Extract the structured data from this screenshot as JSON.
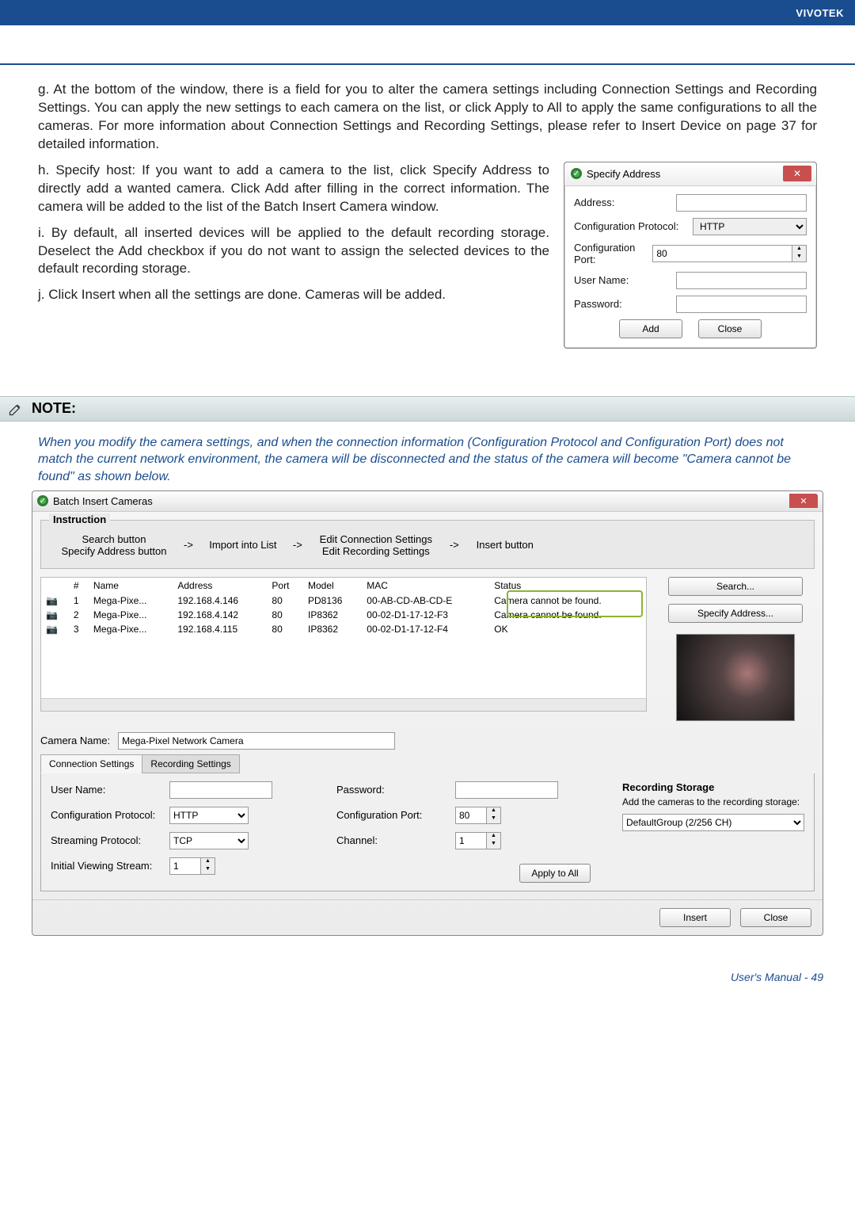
{
  "brand": "VIVOTEK",
  "paragraphs": {
    "g": "At the bottom of the window, there is a field for you to alter the camera settings including Connection Settings and Recording Settings. You can apply the new settings to each camera on the list, or click Apply to All to apply the same configurations to all the cameras. For more information about Connection Settings and Recording Settings, please refer to Insert Device on page 37 for detailed information.",
    "h": "Specify host: If you want to add a camera to the list, click Specify Address to directly add a wanted camera. Click Add after filling in the correct information. The camera will be added to the list of the Batch Insert Camera window.",
    "i": "By default, all inserted devices will be applied to the default recording storage. Deselect the Add checkbox if you do not want to assign the selected devices to the default recording storage.",
    "j": "Click Insert when all the settings are done. Cameras will be added."
  },
  "specify_dialog": {
    "title": "Specify Address",
    "address": "Address:",
    "config_protocol": "Configuration Protocol:",
    "config_protocol_value": "HTTP",
    "config_port": "Configuration Port:",
    "config_port_value": "80",
    "user_name": "User Name:",
    "password": "Password:",
    "add": "Add",
    "close": "Close"
  },
  "note_title": "NOTE:",
  "note_text": "When you modify the camera settings, and when the connection information (Configuration Protocol and Configuration Port) does not match the current network environment, the camera will be disconnected and the status of the camera will become \"Camera cannot be found\" as shown below.",
  "batch_dialog": {
    "title": "Batch Insert Cameras",
    "instruction_title": "Instruction",
    "instr": {
      "c1a": "Search button",
      "c1b": "Specify Address button",
      "c2": "Import into List",
      "c3a": "Edit Connection Settings",
      "c3b": "Edit Recording Settings",
      "c4": "Insert button",
      "arrow": "->"
    },
    "headers": {
      "num": "#",
      "name": "Name",
      "address": "Address",
      "port": "Port",
      "model": "Model",
      "mac": "MAC",
      "status": "Status"
    },
    "rows": [
      {
        "num": "1",
        "name": "Mega-Pixe...",
        "address": "192.168.4.146",
        "port": "80",
        "model": "PD8136",
        "mac": "00-AB-CD-AB-CD-E",
        "status": "Camera cannot be found."
      },
      {
        "num": "2",
        "name": "Mega-Pixe...",
        "address": "192.168.4.142",
        "port": "80",
        "model": "IP8362",
        "mac": "00-02-D1-17-12-F3",
        "status": "Camera cannot be found."
      },
      {
        "num": "3",
        "name": "Mega-Pixe...",
        "address": "192.168.4.115",
        "port": "80",
        "model": "IP8362",
        "mac": "00-02-D1-17-12-F4",
        "status": "OK"
      }
    ],
    "search_btn": "Search...",
    "specify_btn": "Specify Address...",
    "camera_name_label": "Camera Name:",
    "camera_name_value": "Mega-Pixel Network Camera",
    "tabs": {
      "conn": "Connection Settings",
      "rec": "Recording Settings"
    },
    "conn_settings": {
      "user_name": "User Name:",
      "config_protocol": "Configuration Protocol:",
      "config_protocol_value": "HTTP",
      "streaming_protocol": "Streaming Protocol:",
      "streaming_protocol_value": "TCP",
      "initial_viewing": "Initial Viewing Stream:",
      "initial_viewing_value": "1",
      "password": "Password:",
      "config_port": "Configuration Port:",
      "config_port_value": "80",
      "channel": "Channel:",
      "channel_value": "1"
    },
    "recording": {
      "title": "Recording Storage",
      "desc": "Add the cameras to the recording storage:",
      "value": "DefaultGroup (2/256 CH)"
    },
    "apply_all": "Apply to All",
    "insert": "Insert",
    "close": "Close"
  },
  "footer": "User's Manual - 49"
}
